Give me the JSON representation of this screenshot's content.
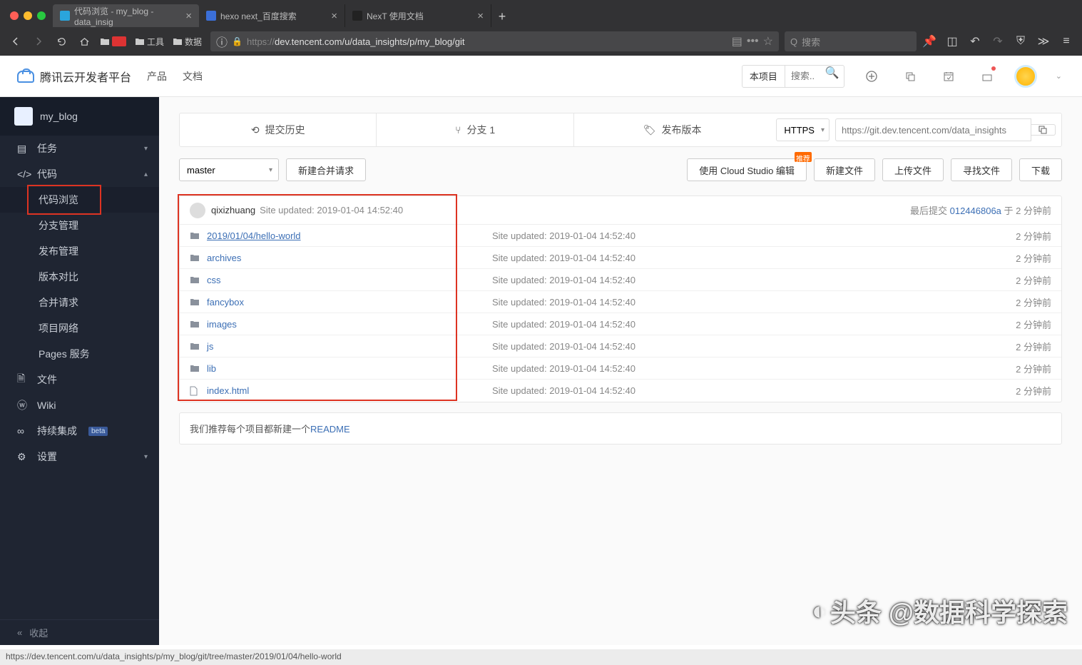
{
  "browser": {
    "tabs": [
      {
        "title": "代码浏览 - my_blog - data_insig",
        "active": true,
        "fav": "#2aa5dc"
      },
      {
        "title": "hexo next_百度搜索",
        "active": false,
        "fav": "#3b6fd8"
      },
      {
        "title": "NexT 使用文档",
        "active": false,
        "fav": "#222"
      }
    ],
    "bookmarks": [
      "工具",
      "数据"
    ],
    "url_prefix": "https://",
    "url_rest": "dev.tencent.com/u/data_insights/p/my_blog/git",
    "search_placeholder": "搜索"
  },
  "header": {
    "brand": "腾讯云开发者平台",
    "nav": [
      "产品",
      "文档"
    ],
    "scope": "本项目",
    "search_placeholder": "搜索..."
  },
  "sidebar": {
    "project": "my_blog",
    "items": [
      {
        "icon": "list",
        "label": "任务",
        "expand": "▾"
      },
      {
        "icon": "code",
        "label": "代码",
        "expand": "▴",
        "children": [
          "代码浏览",
          "分支管理",
          "发布管理",
          "版本对比",
          "合并请求",
          "项目网络",
          "Pages 服务"
        ]
      },
      {
        "icon": "file",
        "label": "文件",
        "expand": ""
      },
      {
        "icon": "wiki",
        "label": "Wiki",
        "expand": ""
      },
      {
        "icon": "ci",
        "label": "持续集成",
        "expand": "",
        "beta": "beta"
      },
      {
        "icon": "gear",
        "label": "设置",
        "expand": "▾"
      }
    ],
    "collapse": "收起"
  },
  "repo_tabs": {
    "history": "提交历史",
    "branch": "分支 1",
    "release": "发布版本"
  },
  "clone": {
    "proto": "HTTPS",
    "url": "https://git.dev.tencent.com/data_insights"
  },
  "actions": {
    "branch": "master",
    "new_mr": "新建合并请求",
    "cloud_studio": "使用 Cloud Studio 编辑",
    "new_file": "新建文件",
    "upload": "上传文件",
    "find": "寻找文件",
    "download": "下载"
  },
  "commit": {
    "author": "qixizhuang",
    "message": "Site updated: 2019-01-04 14:52:40",
    "meta_prefix": "最后提交 ",
    "sha": "012446806a",
    "meta_suffix": " 于 2 分钟前"
  },
  "files": [
    {
      "type": "folder",
      "name": "2019/01/04/hello-world",
      "msg": "Site updated: 2019-01-04 14:52:40",
      "time": "2 分钟前",
      "ul": true
    },
    {
      "type": "folder",
      "name": "archives",
      "msg": "Site updated: 2019-01-04 14:52:40",
      "time": "2 分钟前"
    },
    {
      "type": "folder",
      "name": "css",
      "msg": "Site updated: 2019-01-04 14:52:40",
      "time": "2 分钟前"
    },
    {
      "type": "folder",
      "name": "fancybox",
      "msg": "Site updated: 2019-01-04 14:52:40",
      "time": "2 分钟前"
    },
    {
      "type": "folder",
      "name": "images",
      "msg": "Site updated: 2019-01-04 14:52:40",
      "time": "2 分钟前"
    },
    {
      "type": "folder",
      "name": "js",
      "msg": "Site updated: 2019-01-04 14:52:40",
      "time": "2 分钟前"
    },
    {
      "type": "folder",
      "name": "lib",
      "msg": "Site updated: 2019-01-04 14:52:40",
      "time": "2 分钟前"
    },
    {
      "type": "file",
      "name": "index.html",
      "msg": "Site updated: 2019-01-04 14:52:40",
      "time": "2 分钟前"
    }
  ],
  "readme": {
    "text": "我们推荐每个项目都新建一个",
    "link": "README"
  },
  "watermark": "头条 @数据科学探索",
  "status_url": "https://dev.tencent.com/u/data_insights/p/my_blog/git/tree/master/2019/01/04/hello-world"
}
